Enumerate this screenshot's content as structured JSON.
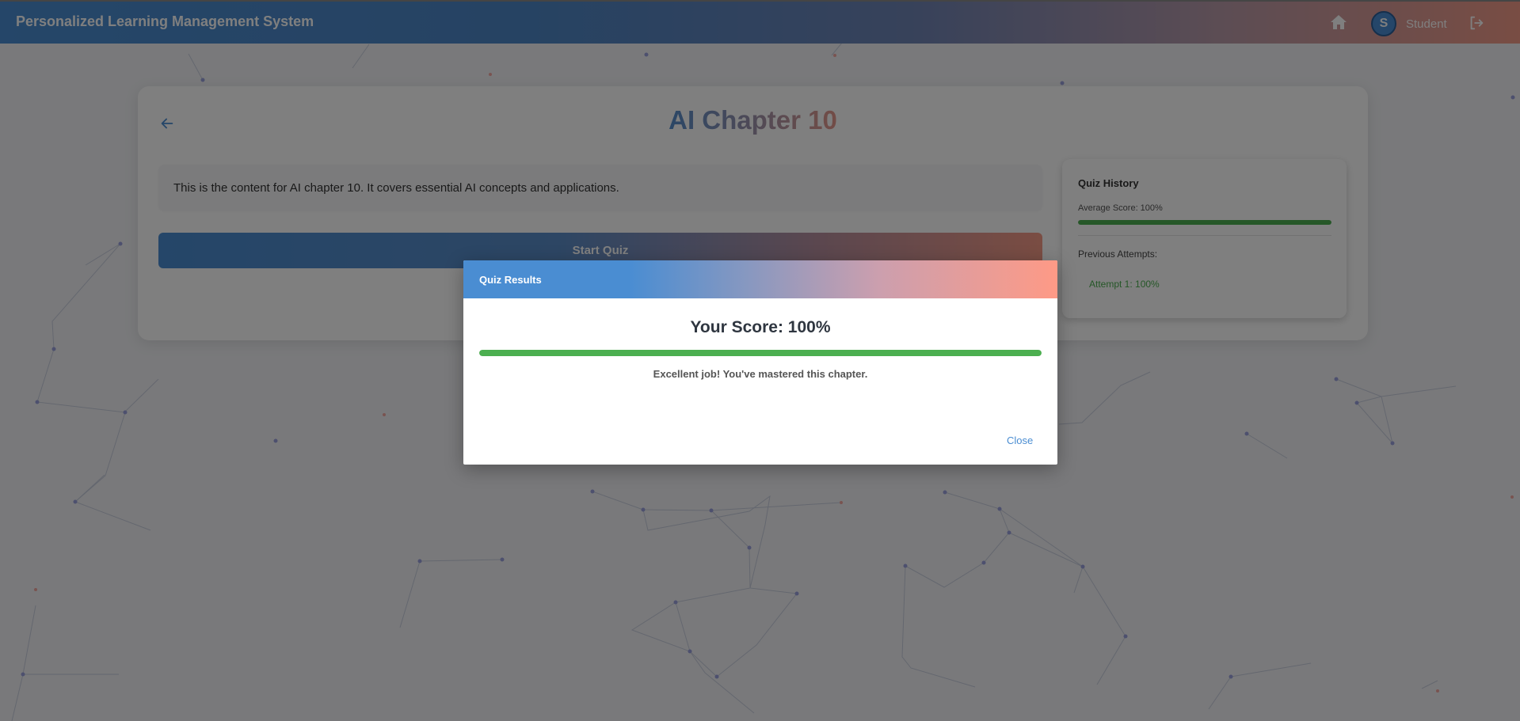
{
  "header": {
    "app_title": "Personalized Learning Management System",
    "home_icon": "home-icon",
    "avatar_letter": "S",
    "user_name": "Student",
    "logout_icon": "logout-icon"
  },
  "main": {
    "back_icon": "arrow-left-icon",
    "chapter_title": "AI Chapter 10",
    "content_text": "This is the content for AI chapter 10. It covers essential AI concepts and applications.",
    "start_quiz_label": "Start Quiz"
  },
  "history": {
    "title": "Quiz History",
    "average_score_label": "Average Score: 100%",
    "average_score_percent": 100,
    "previous_attempts_label": "Previous Attempts:",
    "attempts": [
      "Attempt 1: 100%"
    ]
  },
  "modal": {
    "title": "Quiz Results",
    "score_heading": "Your Score: 100%",
    "score_percent": 100,
    "message": "Excellent job! You've mastered this chapter.",
    "close_label": "Close"
  },
  "colors": {
    "primary": "#4a8dd2",
    "accent": "#f29a88",
    "success": "#4caf50"
  }
}
